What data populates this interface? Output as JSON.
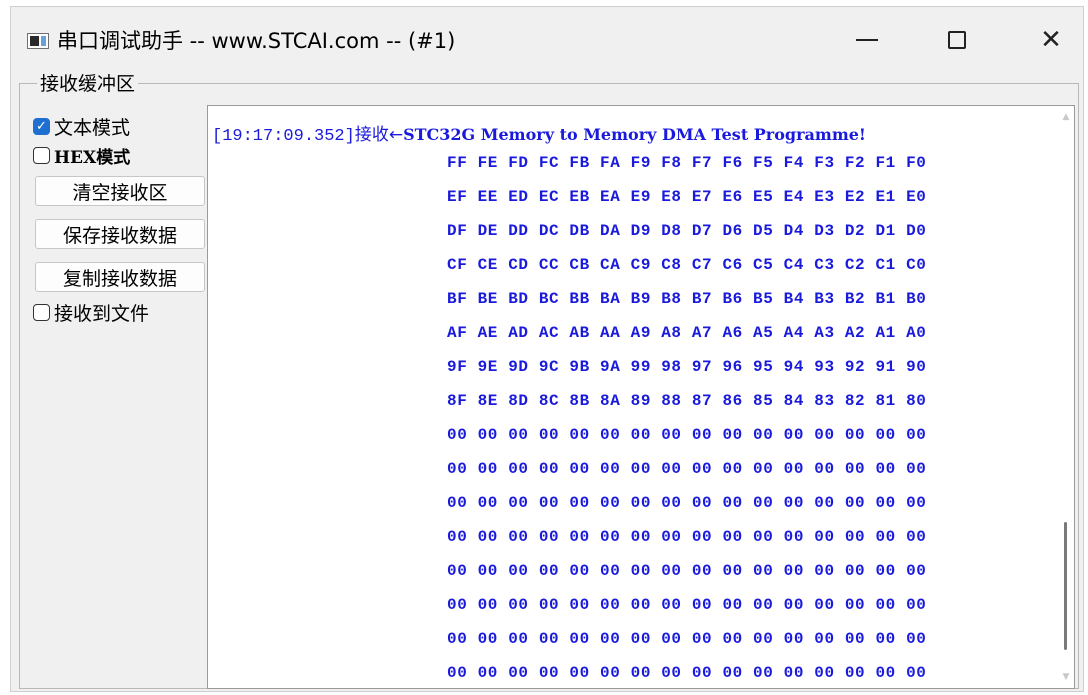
{
  "window": {
    "title": "串口调试助手 -- www.STCAI.com -- (#1)",
    "minimize_glyph": "—",
    "maximize_glyph": "☐",
    "close_glyph": "✕"
  },
  "receive_buffer": {
    "group_label": "接收缓冲区",
    "text_mode_label": "文本模式",
    "text_mode_checked": true,
    "hex_mode_label": "HEX模式",
    "hex_mode_checked": false,
    "clear_button": "清空接收区",
    "save_button": "保存接收数据",
    "copy_button": "复制接收数据",
    "to_file_label": "接收到文件",
    "to_file_checked": false
  },
  "output": {
    "timestamp": "[19:17:09.352]",
    "direction": "接收←",
    "message": "STC32G Memory to Memory DMA Test Programme!",
    "hex_lines": [
      "FF FE FD FC FB FA F9 F8 F7 F6 F5 F4 F3 F2 F1 F0",
      "EF EE ED EC EB EA E9 E8 E7 E6 E5 E4 E3 E2 E1 E0",
      "DF DE DD DC DB DA D9 D8 D7 D6 D5 D4 D3 D2 D1 D0",
      "CF CE CD CC CB CA C9 C8 C7 C6 C5 C4 C3 C2 C1 C0",
      "BF BE BD BC BB BA B9 B8 B7 B6 B5 B4 B3 B2 B1 B0",
      "AF AE AD AC AB AA A9 A8 A7 A6 A5 A4 A3 A2 A1 A0",
      "9F 9E 9D 9C 9B 9A 99 98 97 96 95 94 93 92 91 90",
      "8F 8E 8D 8C 8B 8A 89 88 87 86 85 84 83 82 81 80",
      "00 00 00 00 00 00 00 00 00 00 00 00 00 00 00 00",
      "00 00 00 00 00 00 00 00 00 00 00 00 00 00 00 00",
      "00 00 00 00 00 00 00 00 00 00 00 00 00 00 00 00",
      "00 00 00 00 00 00 00 00 00 00 00 00 00 00 00 00",
      "00 00 00 00 00 00 00 00 00 00 00 00 00 00 00 00",
      "00 00 00 00 00 00 00 00 00 00 00 00 00 00 00 00",
      "00 00 00 00 00 00 00 00 00 00 00 00 00 00 00 00",
      "00 00 00 00 00 00 00 00 00 00 00 00 00 00 00 00"
    ],
    "text_color": "#1a1adc"
  },
  "colors": {
    "checkbox_checked": "#1f6fd0",
    "window_bg": "#f0f0f0"
  }
}
